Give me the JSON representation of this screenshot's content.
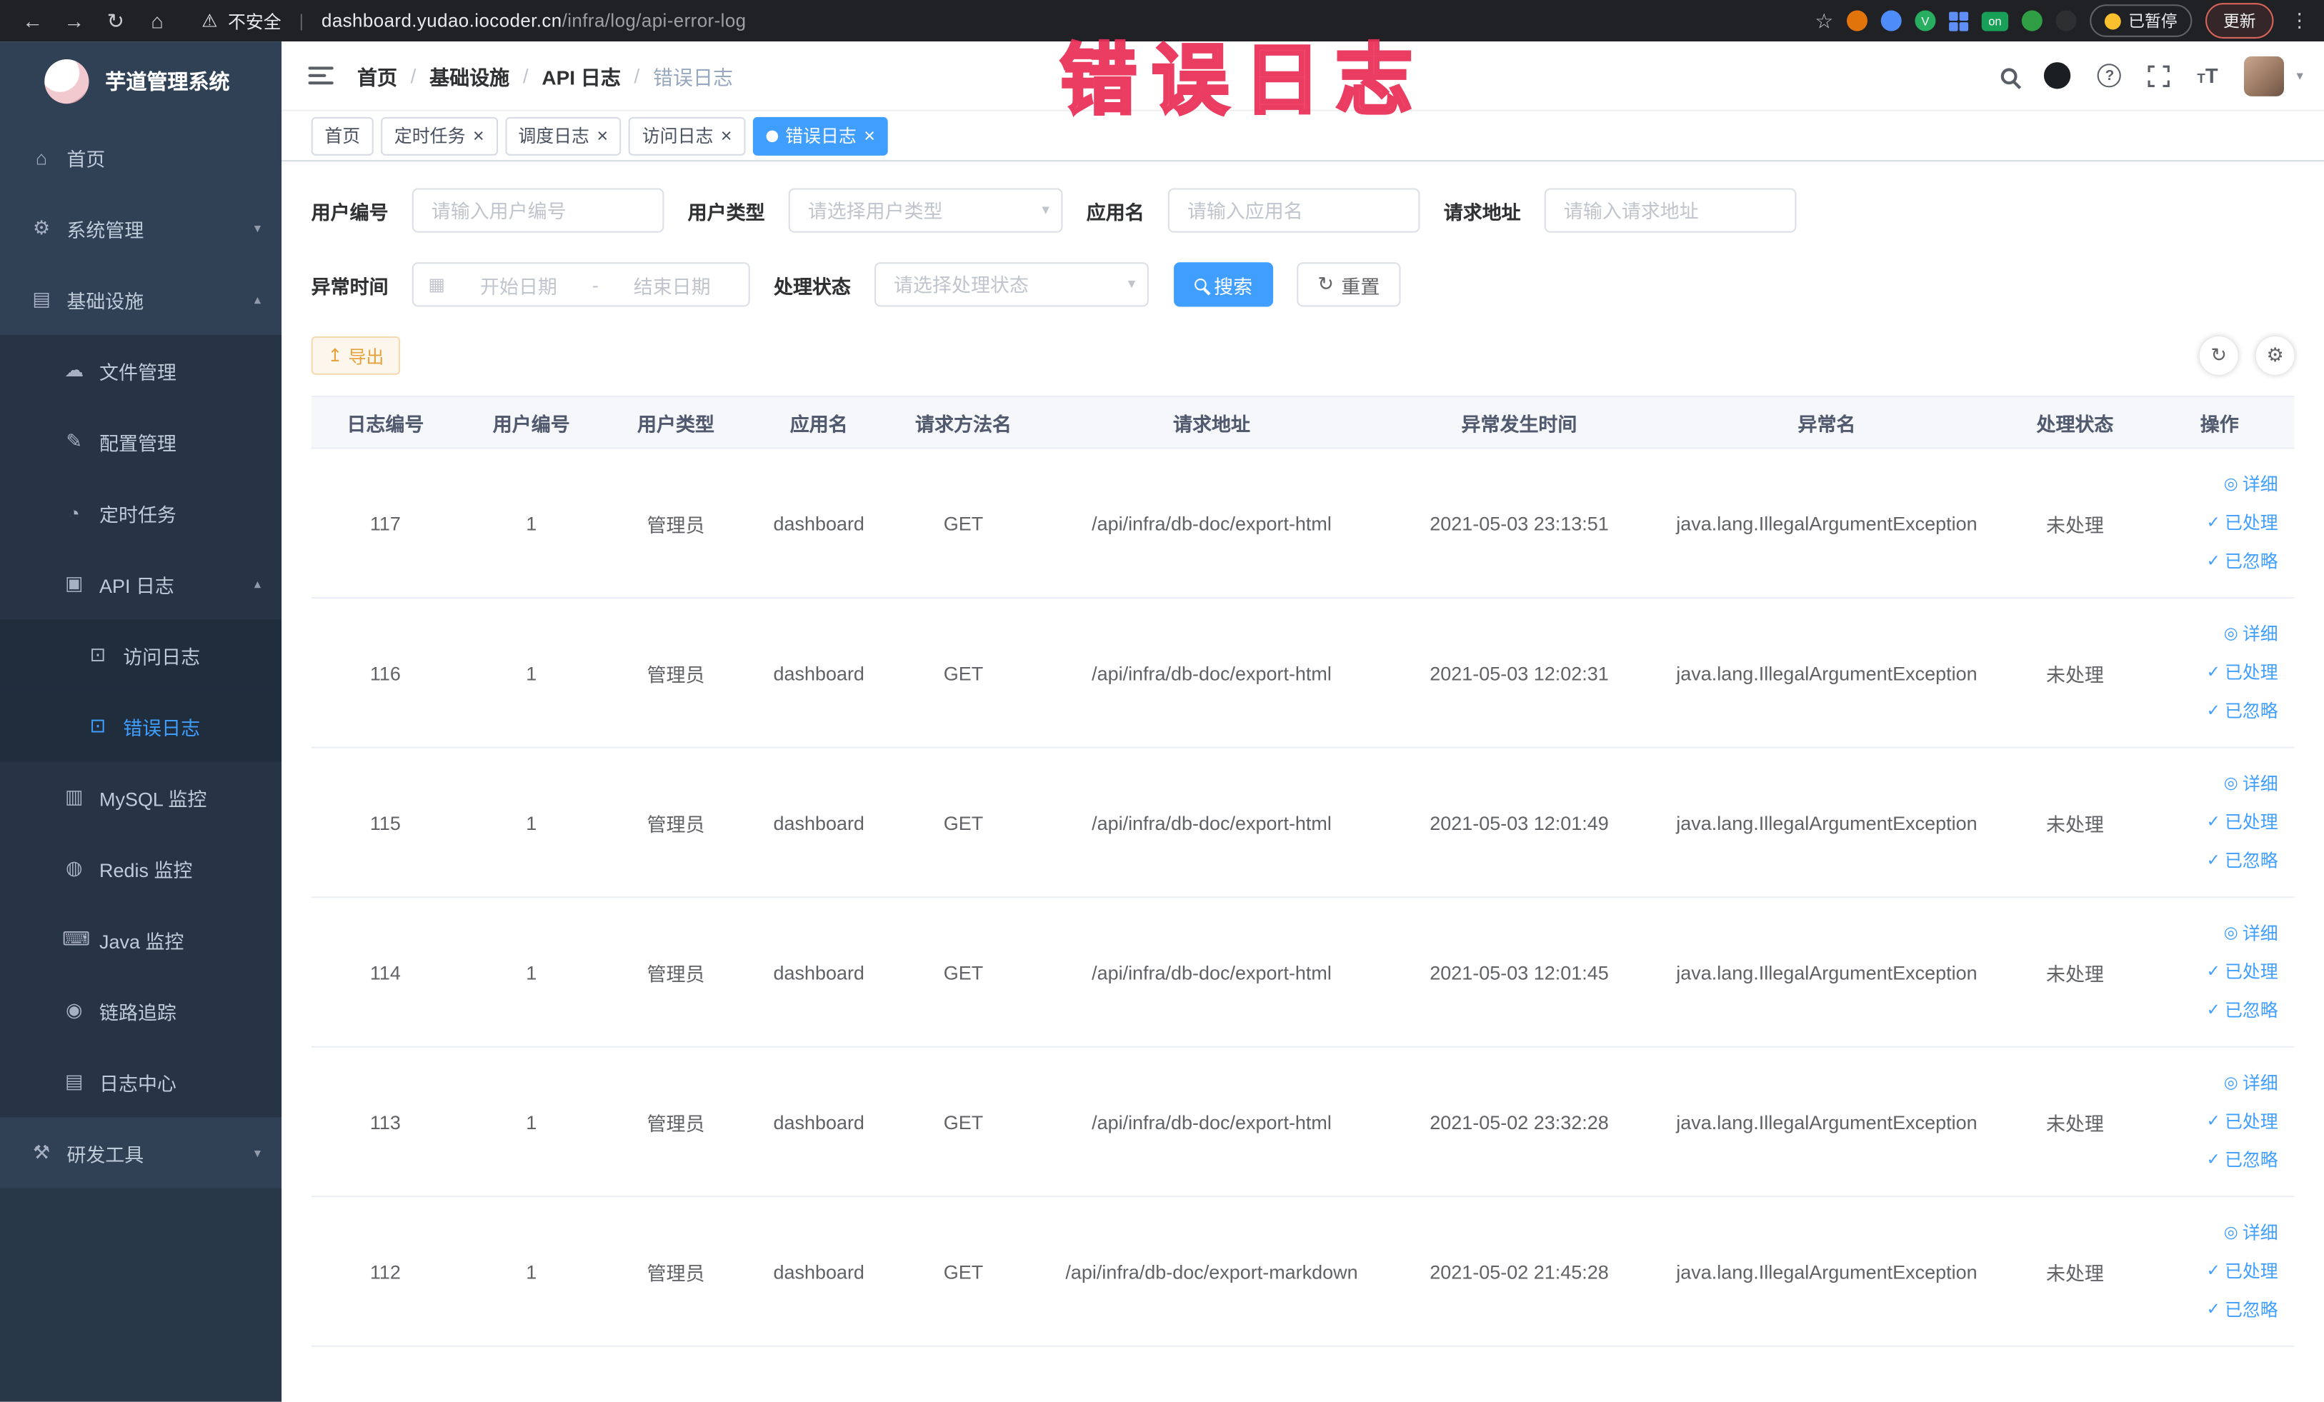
{
  "annotation": {
    "text": "错误日志"
  },
  "browser": {
    "warning": "不安全",
    "url_host": "dashboard.yudao.iocoder.cn",
    "url_path": "/infra/log/api-error-log",
    "ext_on_label": "on",
    "paused_badge": "已暂停",
    "update_label": "更新"
  },
  "sidebar": {
    "title": "芋道管理系统",
    "items": [
      {
        "name": "home",
        "label": "首页",
        "icon": "home",
        "level": 1
      },
      {
        "name": "system-management",
        "label": "系统管理",
        "icon": "gear",
        "level": 1,
        "chevron": "down"
      },
      {
        "name": "infrastructure",
        "label": "基础设施",
        "icon": "infra",
        "level": 1,
        "chevron": "up"
      },
      {
        "name": "file-management",
        "label": "文件管理",
        "icon": "cloud",
        "level": 2
      },
      {
        "name": "config-management",
        "label": "配置管理",
        "icon": "edit",
        "level": 2
      },
      {
        "name": "scheduled-tasks",
        "label": "定时任务",
        "icon": "clock",
        "level": 2
      },
      {
        "name": "api-logs",
        "label": "API 日志",
        "icon": "api",
        "level": 2,
        "chevron": "up"
      },
      {
        "name": "access-log",
        "label": "访问日志",
        "icon": "doc",
        "level": 3
      },
      {
        "name": "error-log",
        "label": "错误日志",
        "icon": "doc",
        "level": 3,
        "active": true
      },
      {
        "name": "mysql-monitor",
        "label": "MySQL 监控",
        "icon": "db",
        "level": 2
      },
      {
        "name": "redis-monitor",
        "label": "Redis 监控",
        "icon": "redis",
        "level": 2
      },
      {
        "name": "java-monitor",
        "label": "Java 监控",
        "icon": "java",
        "level": 2
      },
      {
        "name": "tracing",
        "label": "链路追踪",
        "icon": "trace",
        "level": 2
      },
      {
        "name": "log-center",
        "label": "日志中心",
        "icon": "log",
        "level": 2
      },
      {
        "name": "dev-tools",
        "label": "研发工具",
        "icon": "tools",
        "level": 1,
        "chevron": "down"
      }
    ]
  },
  "navbar": {
    "breadcrumb": [
      {
        "name": "home",
        "label": "首页"
      },
      {
        "name": "infrastructure",
        "label": "基础设施"
      },
      {
        "name": "api-logs",
        "label": "API 日志"
      },
      {
        "name": "error-log",
        "label": "错误日志",
        "current": true
      }
    ]
  },
  "tabs": [
    {
      "name": "home",
      "label": "首页",
      "closable": false,
      "active": false
    },
    {
      "name": "scheduled-tasks",
      "label": "定时任务",
      "closable": true,
      "active": false
    },
    {
      "name": "schedule-log",
      "label": "调度日志",
      "closable": true,
      "active": false
    },
    {
      "name": "access-log",
      "label": "访问日志",
      "closable": true,
      "active": false
    },
    {
      "name": "error-log",
      "label": "错误日志",
      "closable": true,
      "active": true
    }
  ],
  "filters": {
    "user_id": {
      "label": "用户编号",
      "placeholder": "请输入用户编号"
    },
    "user_type": {
      "label": "用户类型",
      "placeholder": "请选择用户类型"
    },
    "app_name": {
      "label": "应用名",
      "placeholder": "请输入应用名"
    },
    "request_url": {
      "label": "请求地址",
      "placeholder": "请输入请求地址"
    },
    "exception_time": {
      "label": "异常时间",
      "start_placeholder": "开始日期",
      "separator": "-",
      "end_placeholder": "结束日期"
    },
    "process_status": {
      "label": "处理状态",
      "placeholder": "请选择处理状态"
    },
    "search_label": "搜索",
    "reset_label": "重置"
  },
  "toolbar": {
    "export_label": "导出"
  },
  "table": {
    "columns": [
      "日志编号",
      "用户编号",
      "用户类型",
      "应用名",
      "请求方法名",
      "请求地址",
      "异常发生时间",
      "异常名",
      "处理状态",
      "操作"
    ],
    "actions": [
      {
        "name": "detail",
        "icon": "eye",
        "label": "详细"
      },
      {
        "name": "processed",
        "icon": "check",
        "label": "已处理"
      },
      {
        "name": "ignored",
        "icon": "check",
        "label": "已忽略"
      }
    ],
    "rows": [
      {
        "id": "117",
        "user_id": "1",
        "user_type": "管理员",
        "app": "dashboard",
        "method": "GET",
        "url": "/api/infra/db-doc/export-html",
        "time": "2021-05-03 23:13:51",
        "exception": "java.lang.IllegalArgumentException",
        "status": "未处理"
      },
      {
        "id": "116",
        "user_id": "1",
        "user_type": "管理员",
        "app": "dashboard",
        "method": "GET",
        "url": "/api/infra/db-doc/export-html",
        "time": "2021-05-03 12:02:31",
        "exception": "java.lang.IllegalArgumentException",
        "status": "未处理"
      },
      {
        "id": "115",
        "user_id": "1",
        "user_type": "管理员",
        "app": "dashboard",
        "method": "GET",
        "url": "/api/infra/db-doc/export-html",
        "time": "2021-05-03 12:01:49",
        "exception": "java.lang.IllegalArgumentException",
        "status": "未处理"
      },
      {
        "id": "114",
        "user_id": "1",
        "user_type": "管理员",
        "app": "dashboard",
        "method": "GET",
        "url": "/api/infra/db-doc/export-html",
        "time": "2021-05-03 12:01:45",
        "exception": "java.lang.IllegalArgumentException",
        "status": "未处理"
      },
      {
        "id": "113",
        "user_id": "1",
        "user_type": "管理员",
        "app": "dashboard",
        "method": "GET",
        "url": "/api/infra/db-doc/export-html",
        "time": "2021-05-02 23:32:28",
        "exception": "java.lang.IllegalArgumentException",
        "status": "未处理"
      },
      {
        "id": "112",
        "user_id": "1",
        "user_type": "管理员",
        "app": "dashboard",
        "method": "GET",
        "url": "/api/infra/db-doc/export-markdown",
        "time": "2021-05-02 21:45:28",
        "exception": "java.lang.IllegalArgumentException",
        "status": "未处理"
      }
    ]
  }
}
